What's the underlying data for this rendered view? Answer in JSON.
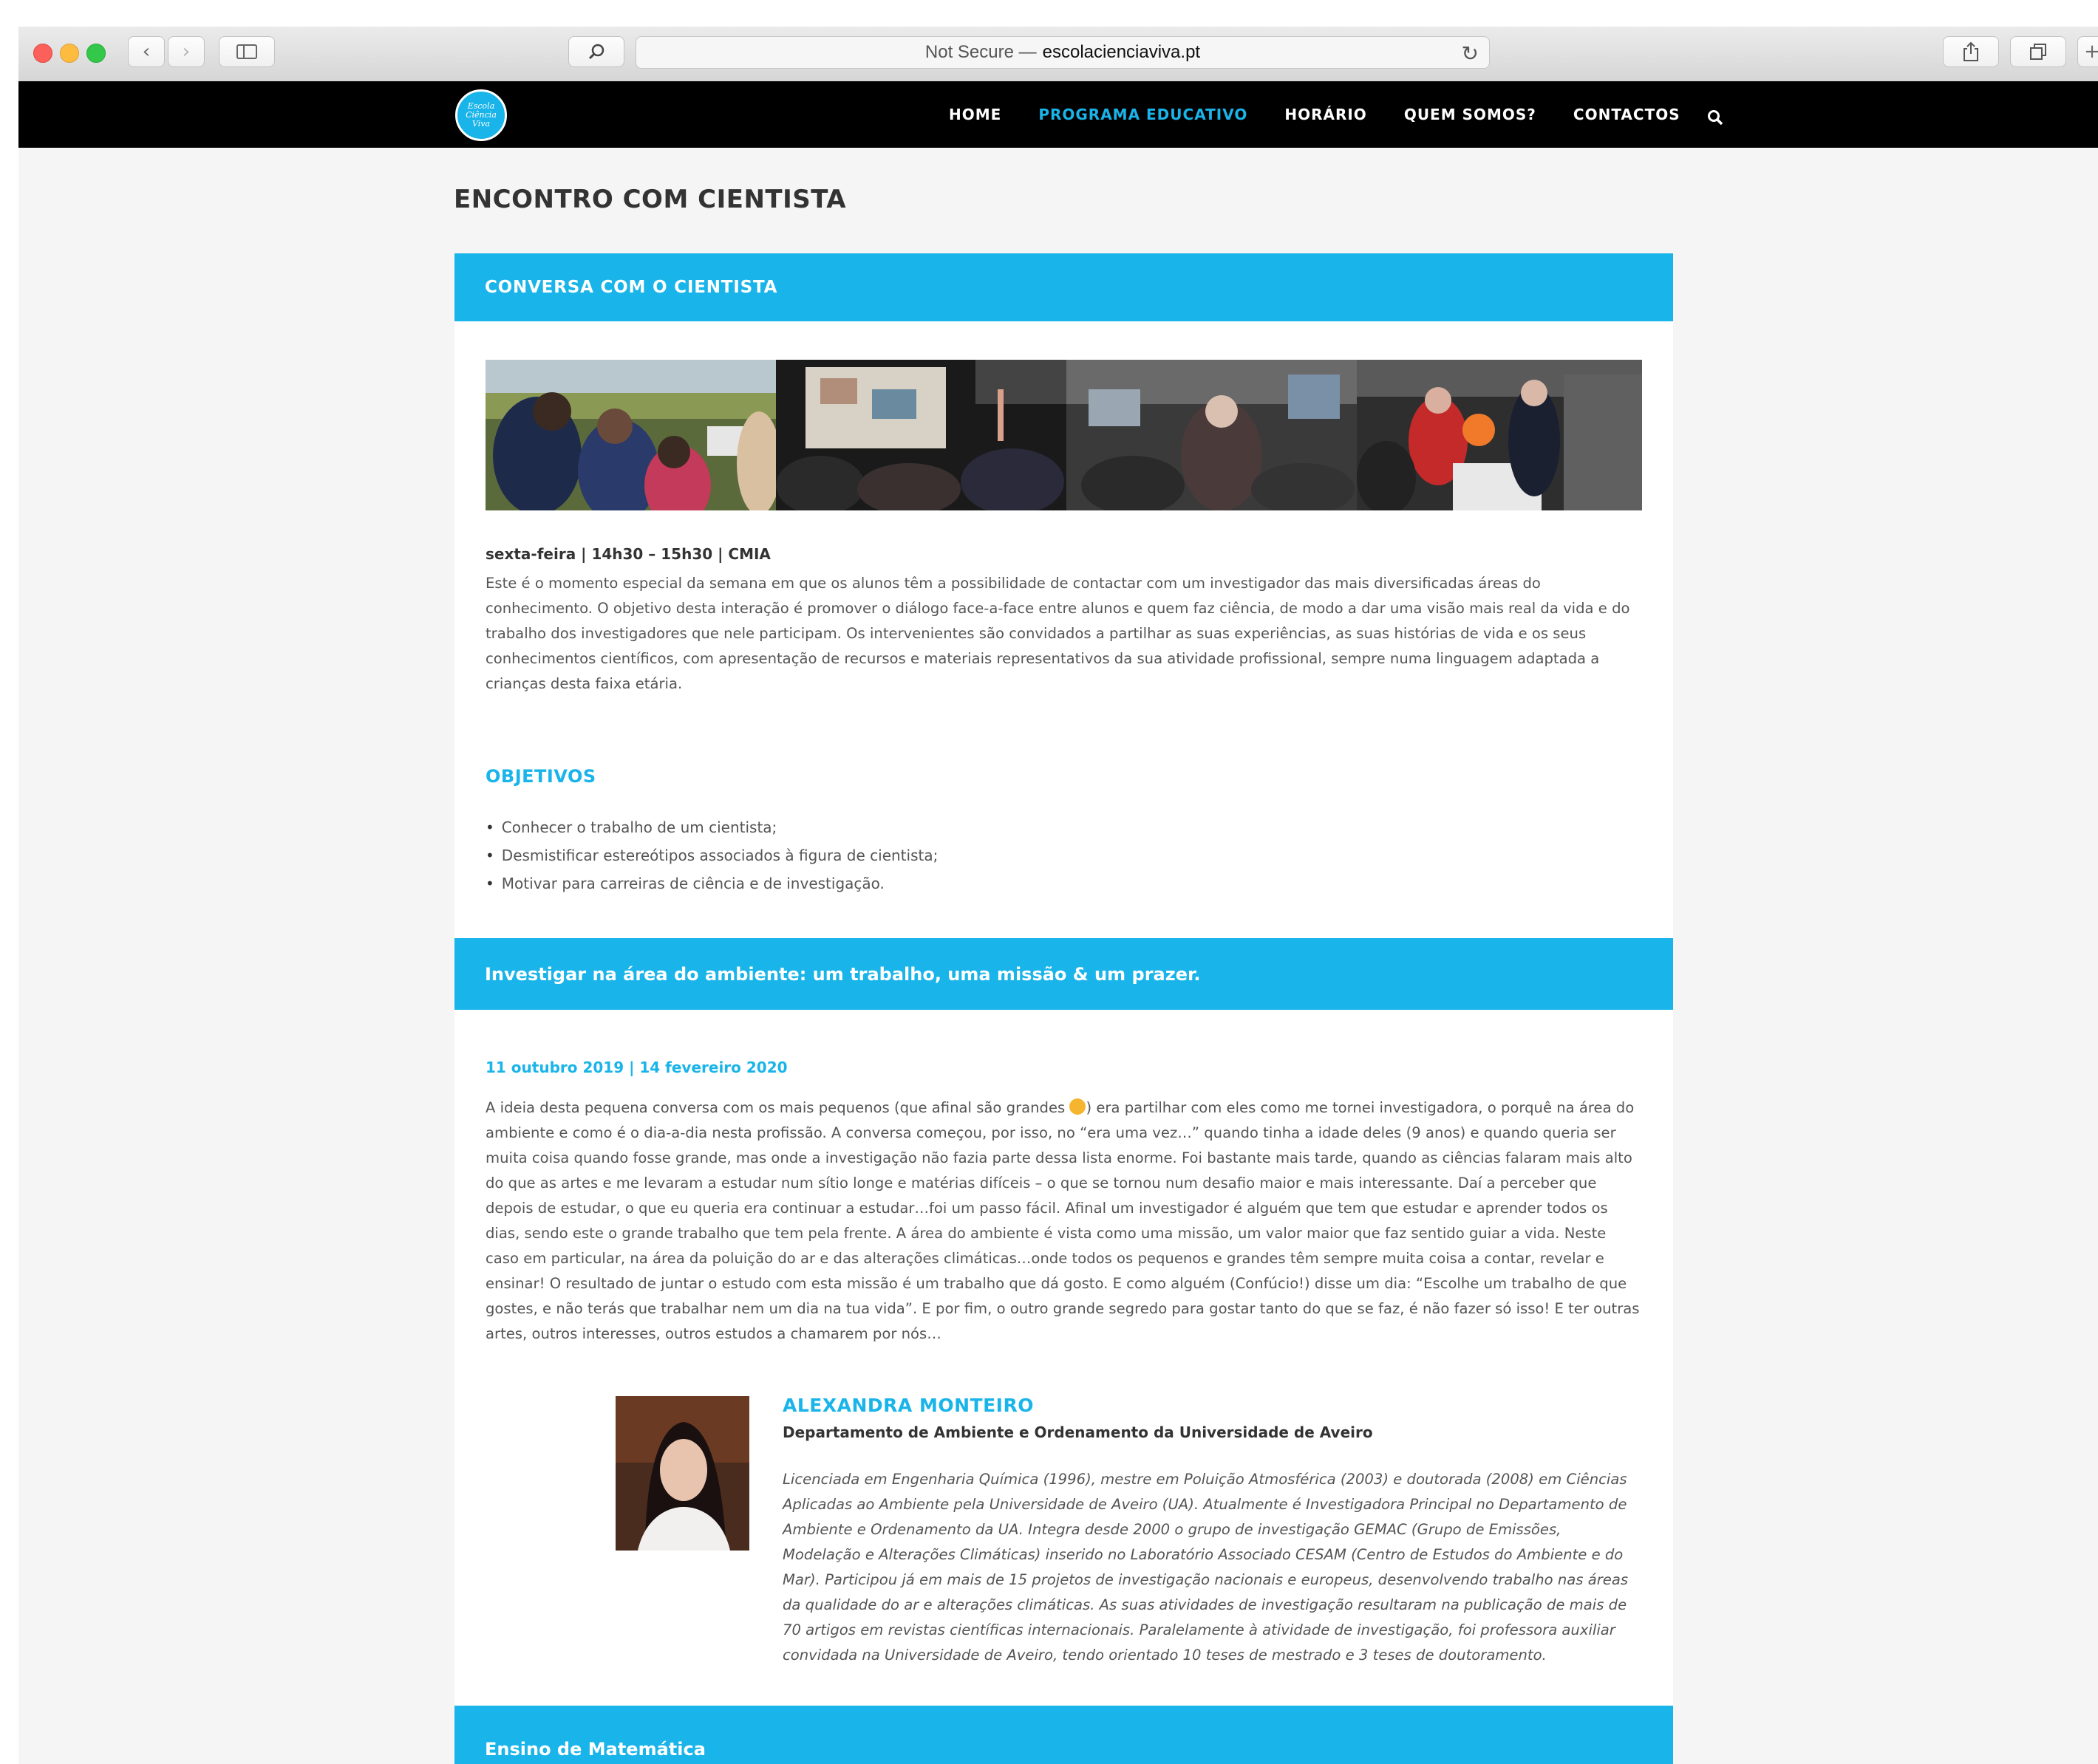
{
  "browser": {
    "address_prefix": "Not Secure —",
    "address_domain": "escolacienciaviva.pt"
  },
  "site": {
    "logo_text": "Escola Ciência Viva",
    "nav": [
      {
        "label": "HOME",
        "active": false
      },
      {
        "label": "PROGRAMA EDUCATIVO",
        "active": true
      },
      {
        "label": "HORÁRIO",
        "active": false
      },
      {
        "label": "QUEM SOMOS?",
        "active": false
      },
      {
        "label": "CONTACTOS",
        "active": false
      }
    ],
    "accent_color": "#19b4e9"
  },
  "page": {
    "title": "ENCONTRO COM CIENTISTA",
    "section1": {
      "header": "CONVERSA COM O CIENTISTA",
      "schedule": "sexta-feira | 14h30 – 15h30 | CMIA",
      "description": "Este é o momento especial da semana em que os alunos têm a possibilidade de contactar com um investigador das mais diversificadas áreas do conhecimento. O objetivo desta interação é promover o diálogo face-a-face entre alunos e quem faz ciência, de modo a dar uma visão mais real da vida e do trabalho dos investigadores que nele participam. Os intervenientes são convidados a partilhar as suas experiências, as suas histórias de vida e os seus conhecimentos científicos, com apresentação de recursos e materiais representativos da sua atividade profissional, sempre numa linguagem adaptada a crianças desta faixa etária.",
      "objectives_title": "OBJETIVOS",
      "objectives": [
        "Conhecer o trabalho de um cientista;",
        "Desmistificar estereótipos associados à figura de cientista;",
        "Motivar para carreiras de ciência e de investigação."
      ]
    },
    "section2": {
      "header": "Investigar na área do ambiente: um trabalho, uma missão & um prazer.",
      "dates": "11 outubro 2019 | 14 fevereiro 2020",
      "text_before_emoji": "A ideia desta pequena conversa com os mais pequenos (que afinal são grandes ",
      "emoji_name": "smiling-face-emoji",
      "text_after_emoji": ") era partilhar com eles como me tornei investigadora, o porquê na área do ambiente e como é o dia-a-dia nesta profissão. A conversa começou, por isso, no “era uma vez…” quando tinha a idade deles (9 anos) e quando queria ser muita coisa quando fosse grande, mas onde a investigação não fazia parte dessa lista enorme. Foi bastante mais tarde, quando as ciências falaram mais alto do que as artes e me levaram a estudar num sítio longe e matérias difíceis – o que se tornou num desafio maior e mais interessante. Daí a perceber que depois de estudar, o que eu queria era continuar a estudar…foi um passo fácil. Afinal um investigador é alguém que tem que estudar e aprender todos os dias, sendo este o grande trabalho que tem pela frente. A área do ambiente é vista como uma missão, um valor maior que faz sentido guiar a vida. Neste caso em particular, na área da poluição do ar e das alterações climáticas…onde todos os pequenos e grandes têm sempre muita coisa a contar, revelar e ensinar! O resultado de juntar o estudo com esta missão é um trabalho que dá gosto. E como alguém (Confúcio!) disse um dia: “Escolhe um trabalho de que gostes, e não terás que trabalhar nem um dia na tua vida”. E por fim, o outro grande segredo para gostar tanto do que se faz, é não fazer só isso! E ter outras artes, outros interesses, outros estudos a chamarem por nós…",
      "person": {
        "name": "ALEXANDRA MONTEIRO",
        "department": "Departamento de Ambiente e Ordenamento da Universidade de Aveiro",
        "bio": "Licenciada em Engenharia Química (1996), mestre em Poluição Atmosférica (2003) e doutorada (2008) em Ciências Aplicadas ao Ambiente pela Universidade de Aveiro (UA). Atualmente é Investigadora Principal no Departamento de Ambiente e Ordenamento da UA. Integra desde 2000 o grupo de investigação GEMAC (Grupo de Emissões, Modelação e Alterações Climáticas) inserido no Laboratório Associado CESAM (Centro de Estudos do Ambiente e do Mar). Participou já em mais de 15 projetos de investigação nacionais e europeus, desenvolvendo trabalho nas áreas da qualidade do ar e alterações climáticas. As suas atividades de investigação resultaram na publicação de mais de 70 artigos em revistas científicas internacionais. Paralelamente à atividade de investigação, foi professora auxiliar convidada na Universidade de Aveiro, tendo orientado 10 teses de mestrado e 3 teses de doutoramento."
      }
    },
    "section3": {
      "header": "Ensino de Matemática"
    }
  }
}
